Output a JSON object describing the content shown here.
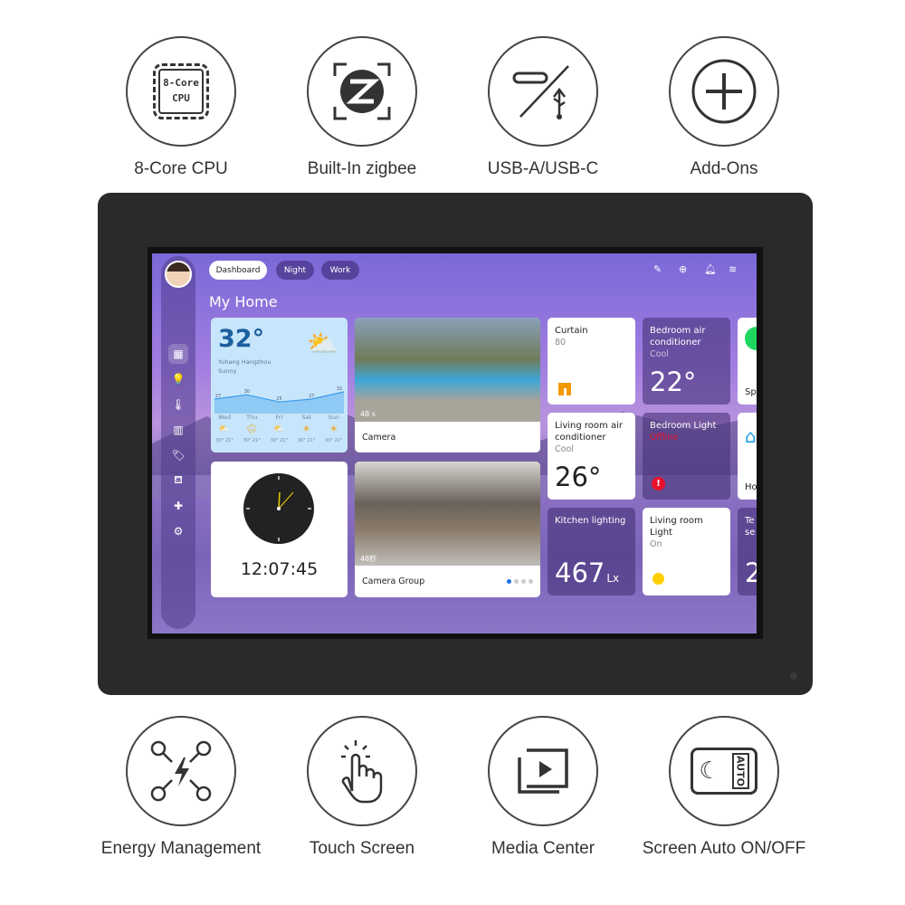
{
  "features_top": [
    {
      "icon": "cpu-chip-icon",
      "label": "8-Core CPU",
      "chip_text": [
        "8-Core",
        "CPU"
      ]
    },
    {
      "icon": "zigbee-icon",
      "label": "Built-In zigbee"
    },
    {
      "icon": "usb-icon",
      "label": "USB-A/USB-C"
    },
    {
      "icon": "plus-icon",
      "label": "Add-Ons"
    }
  ],
  "features_bottom": [
    {
      "icon": "energy-network-icon",
      "label": "Energy Management"
    },
    {
      "icon": "touch-hand-icon",
      "label": "Touch Screen"
    },
    {
      "icon": "play-screen-icon",
      "label": "Media Center"
    },
    {
      "icon": "moon-auto-icon",
      "label": "Screen Auto ON/OFF",
      "badge": "AUTO"
    }
  ],
  "screen": {
    "tabs": [
      {
        "label": "Dashboard",
        "active": true
      },
      {
        "label": "Night"
      },
      {
        "label": "Work"
      }
    ],
    "top_icons": [
      "edit-icon",
      "add-icon",
      "bell-icon",
      "wifi-icon"
    ],
    "title": "My Home",
    "sidebar": [
      "dashboard-icon",
      "bulb-icon",
      "climate-icon",
      "energy-icon",
      "tag-icon",
      "chair-icon",
      "puzzle-icon",
      "settings-icon"
    ],
    "weather": {
      "temp": "32°",
      "location": "Yuhang Hangzhou",
      "condition": "Sunny",
      "chart": [
        27,
        30,
        25,
        27,
        32
      ],
      "days": [
        {
          "d": "Wed",
          "r": "30° 21°",
          "icon": "partly-cloudy"
        },
        {
          "d": "Thu",
          "r": "30° 21°",
          "icon": "rain"
        },
        {
          "d": "Fri",
          "r": "30° 21°",
          "icon": "partly-cloudy"
        },
        {
          "d": "Sat",
          "r": "30° 21°",
          "icon": "sun"
        },
        {
          "d": "Sun",
          "r": "30° 21°",
          "icon": "sun"
        }
      ]
    },
    "clock": {
      "time": "12:07:45"
    },
    "camera": {
      "label": "Camera",
      "stamp": "48 s"
    },
    "camera_group": {
      "label": "Camera Group",
      "stamp": "48秒",
      "pages": 4,
      "current_page": 1
    },
    "tiles": {
      "curtain": {
        "name": "Curtain",
        "value": "80"
      },
      "bedroom_ac": {
        "name": "Bedroom air conditioner",
        "mode": "Cool",
        "temp": "22°"
      },
      "living_ac": {
        "name": "Living room air conditioner",
        "mode": "Cool",
        "temp": "26°"
      },
      "bedroom_light": {
        "name": "Bedroom Light",
        "status": "Offline"
      },
      "kitchen": {
        "name": "Kitchen lighting",
        "value": "467",
        "unit": "Lx"
      },
      "living_light": {
        "name": "Living room Light",
        "status": "On"
      },
      "partial_1": "Sp",
      "partial_2": "Ho",
      "partial_3a": "Te",
      "partial_3b": "se",
      "partial_3v": "2"
    },
    "colors": {
      "accent": "#1a73e8",
      "offline": "#e8102a",
      "curtain": "#f39800",
      "bulb": "#ffd000"
    }
  }
}
